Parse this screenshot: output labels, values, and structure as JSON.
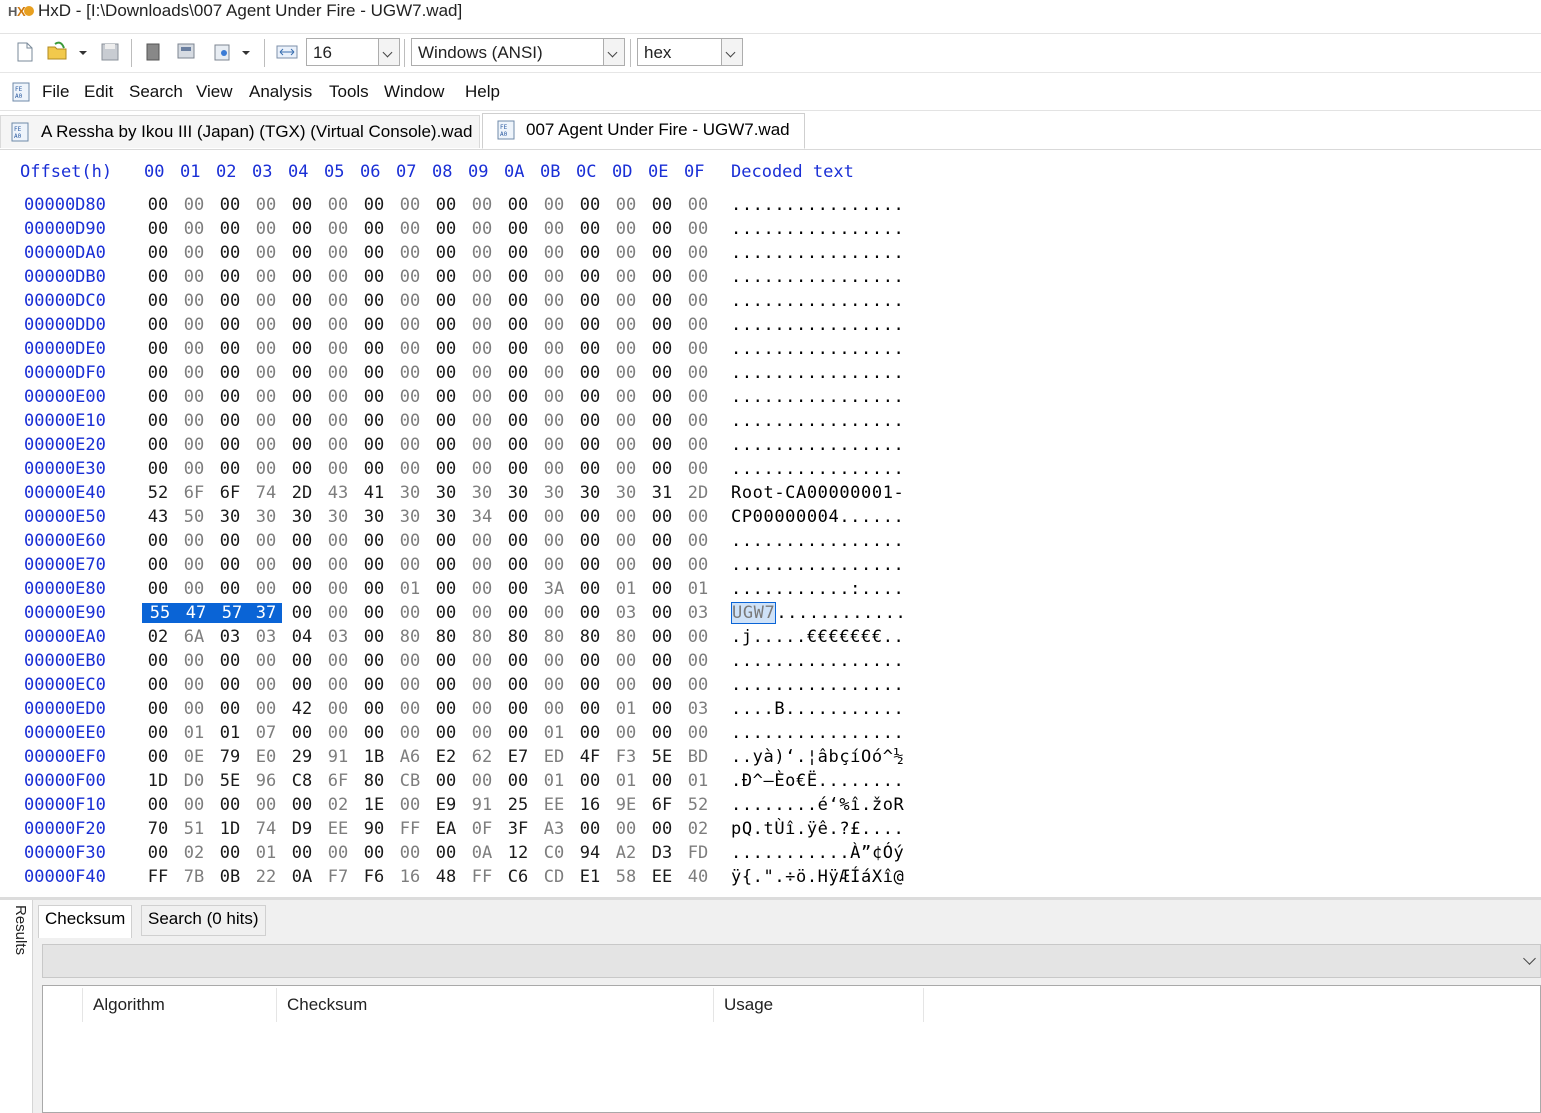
{
  "window": {
    "title": "HxD - [I:\\Downloads\\007 Agent Under Fire - UGW7.wad]"
  },
  "toolbar": {
    "bytes_per_row": "16",
    "charset": "Windows (ANSI)",
    "offset_base": "hex"
  },
  "menu": {
    "items": [
      "File",
      "Edit",
      "Search",
      "View",
      "Analysis",
      "Tools",
      "Window",
      "Help"
    ]
  },
  "tabs": [
    {
      "label": "A Ressha by Ikou III (Japan) (TGX) (Virtual Console).wad",
      "active": false
    },
    {
      "label": "007 Agent Under Fire - UGW7.wad",
      "active": true
    }
  ],
  "hexview": {
    "offset_header": "Offset(h)",
    "column_headers": [
      "00",
      "01",
      "02",
      "03",
      "04",
      "05",
      "06",
      "07",
      "08",
      "09",
      "0A",
      "0B",
      "0C",
      "0D",
      "0E",
      "0F"
    ],
    "decoded_header": "Decoded text",
    "selection": {
      "row": 17,
      "start": 0,
      "end": 3,
      "text": "UGW7"
    },
    "rows": [
      {
        "offset": "00000D80",
        "bytes": [
          "00",
          "00",
          "00",
          "00",
          "00",
          "00",
          "00",
          "00",
          "00",
          "00",
          "00",
          "00",
          "00",
          "00",
          "00",
          "00"
        ],
        "text": "................"
      },
      {
        "offset": "00000D90",
        "bytes": [
          "00",
          "00",
          "00",
          "00",
          "00",
          "00",
          "00",
          "00",
          "00",
          "00",
          "00",
          "00",
          "00",
          "00",
          "00",
          "00"
        ],
        "text": "................"
      },
      {
        "offset": "00000DA0",
        "bytes": [
          "00",
          "00",
          "00",
          "00",
          "00",
          "00",
          "00",
          "00",
          "00",
          "00",
          "00",
          "00",
          "00",
          "00",
          "00",
          "00"
        ],
        "text": "................"
      },
      {
        "offset": "00000DB0",
        "bytes": [
          "00",
          "00",
          "00",
          "00",
          "00",
          "00",
          "00",
          "00",
          "00",
          "00",
          "00",
          "00",
          "00",
          "00",
          "00",
          "00"
        ],
        "text": "................"
      },
      {
        "offset": "00000DC0",
        "bytes": [
          "00",
          "00",
          "00",
          "00",
          "00",
          "00",
          "00",
          "00",
          "00",
          "00",
          "00",
          "00",
          "00",
          "00",
          "00",
          "00"
        ],
        "text": "................"
      },
      {
        "offset": "00000DD0",
        "bytes": [
          "00",
          "00",
          "00",
          "00",
          "00",
          "00",
          "00",
          "00",
          "00",
          "00",
          "00",
          "00",
          "00",
          "00",
          "00",
          "00"
        ],
        "text": "................"
      },
      {
        "offset": "00000DE0",
        "bytes": [
          "00",
          "00",
          "00",
          "00",
          "00",
          "00",
          "00",
          "00",
          "00",
          "00",
          "00",
          "00",
          "00",
          "00",
          "00",
          "00"
        ],
        "text": "................"
      },
      {
        "offset": "00000DF0",
        "bytes": [
          "00",
          "00",
          "00",
          "00",
          "00",
          "00",
          "00",
          "00",
          "00",
          "00",
          "00",
          "00",
          "00",
          "00",
          "00",
          "00"
        ],
        "text": "................"
      },
      {
        "offset": "00000E00",
        "bytes": [
          "00",
          "00",
          "00",
          "00",
          "00",
          "00",
          "00",
          "00",
          "00",
          "00",
          "00",
          "00",
          "00",
          "00",
          "00",
          "00"
        ],
        "text": "................"
      },
      {
        "offset": "00000E10",
        "bytes": [
          "00",
          "00",
          "00",
          "00",
          "00",
          "00",
          "00",
          "00",
          "00",
          "00",
          "00",
          "00",
          "00",
          "00",
          "00",
          "00"
        ],
        "text": "................"
      },
      {
        "offset": "00000E20",
        "bytes": [
          "00",
          "00",
          "00",
          "00",
          "00",
          "00",
          "00",
          "00",
          "00",
          "00",
          "00",
          "00",
          "00",
          "00",
          "00",
          "00"
        ],
        "text": "................"
      },
      {
        "offset": "00000E30",
        "bytes": [
          "00",
          "00",
          "00",
          "00",
          "00",
          "00",
          "00",
          "00",
          "00",
          "00",
          "00",
          "00",
          "00",
          "00",
          "00",
          "00"
        ],
        "text": "................"
      },
      {
        "offset": "00000E40",
        "bytes": [
          "52",
          "6F",
          "6F",
          "74",
          "2D",
          "43",
          "41",
          "30",
          "30",
          "30",
          "30",
          "30",
          "30",
          "30",
          "31",
          "2D"
        ],
        "text": "Root-CA00000001-"
      },
      {
        "offset": "00000E50",
        "bytes": [
          "43",
          "50",
          "30",
          "30",
          "30",
          "30",
          "30",
          "30",
          "30",
          "34",
          "00",
          "00",
          "00",
          "00",
          "00",
          "00"
        ],
        "text": "CP00000004......"
      },
      {
        "offset": "00000E60",
        "bytes": [
          "00",
          "00",
          "00",
          "00",
          "00",
          "00",
          "00",
          "00",
          "00",
          "00",
          "00",
          "00",
          "00",
          "00",
          "00",
          "00"
        ],
        "text": "................"
      },
      {
        "offset": "00000E70",
        "bytes": [
          "00",
          "00",
          "00",
          "00",
          "00",
          "00",
          "00",
          "00",
          "00",
          "00",
          "00",
          "00",
          "00",
          "00",
          "00",
          "00"
        ],
        "text": "................"
      },
      {
        "offset": "00000E80",
        "bytes": [
          "00",
          "00",
          "00",
          "00",
          "00",
          "00",
          "00",
          "01",
          "00",
          "00",
          "00",
          "3A",
          "00",
          "01",
          "00",
          "01"
        ],
        "text": "...........:...."
      },
      {
        "offset": "00000E90",
        "bytes": [
          "55",
          "47",
          "57",
          "37",
          "00",
          "00",
          "00",
          "00",
          "00",
          "00",
          "00",
          "00",
          "00",
          "03",
          "00",
          "03"
        ],
        "text": "UGW7............"
      },
      {
        "offset": "00000EA0",
        "bytes": [
          "02",
          "6A",
          "03",
          "03",
          "04",
          "03",
          "00",
          "80",
          "80",
          "80",
          "80",
          "80",
          "80",
          "80",
          "00",
          "00"
        ],
        "text": ".j.....€€€€€€€.."
      },
      {
        "offset": "00000EB0",
        "bytes": [
          "00",
          "00",
          "00",
          "00",
          "00",
          "00",
          "00",
          "00",
          "00",
          "00",
          "00",
          "00",
          "00",
          "00",
          "00",
          "00"
        ],
        "text": "................"
      },
      {
        "offset": "00000EC0",
        "bytes": [
          "00",
          "00",
          "00",
          "00",
          "00",
          "00",
          "00",
          "00",
          "00",
          "00",
          "00",
          "00",
          "00",
          "00",
          "00",
          "00"
        ],
        "text": "................"
      },
      {
        "offset": "00000ED0",
        "bytes": [
          "00",
          "00",
          "00",
          "00",
          "42",
          "00",
          "00",
          "00",
          "00",
          "00",
          "00",
          "00",
          "00",
          "01",
          "00",
          "03"
        ],
        "text": "....B..........."
      },
      {
        "offset": "00000EE0",
        "bytes": [
          "00",
          "01",
          "01",
          "07",
          "00",
          "00",
          "00",
          "00",
          "00",
          "00",
          "00",
          "01",
          "00",
          "00",
          "00",
          "00"
        ],
        "text": "................"
      },
      {
        "offset": "00000EF0",
        "bytes": [
          "00",
          "0E",
          "79",
          "E0",
          "29",
          "91",
          "1B",
          "A6",
          "E2",
          "62",
          "E7",
          "ED",
          "4F",
          "F3",
          "5E",
          "BD"
        ],
        "text": "..yà)‘.¦âbçíOó^½"
      },
      {
        "offset": "00000F00",
        "bytes": [
          "1D",
          "D0",
          "5E",
          "96",
          "C8",
          "6F",
          "80",
          "CB",
          "00",
          "00",
          "00",
          "01",
          "00",
          "01",
          "00",
          "01"
        ],
        "text": ".Ð^–Èo€Ë........"
      },
      {
        "offset": "00000F10",
        "bytes": [
          "00",
          "00",
          "00",
          "00",
          "00",
          "02",
          "1E",
          "00",
          "E9",
          "91",
          "25",
          "EE",
          "16",
          "9E",
          "6F",
          "52"
        ],
        "text": "........é‘%î.žoR"
      },
      {
        "offset": "00000F20",
        "bytes": [
          "70",
          "51",
          "1D",
          "74",
          "D9",
          "EE",
          "90",
          "FF",
          "EA",
          "0F",
          "3F",
          "A3",
          "00",
          "00",
          "00",
          "02"
        ],
        "text": "pQ.tÙî.ÿê.?£...."
      },
      {
        "offset": "00000F30",
        "bytes": [
          "00",
          "02",
          "00",
          "01",
          "00",
          "00",
          "00",
          "00",
          "00",
          "0A",
          "12",
          "C0",
          "94",
          "A2",
          "D3",
          "FD"
        ],
        "text": "...........À”¢Óý"
      },
      {
        "offset": "00000F40",
        "bytes": [
          "FF",
          "7B",
          "0B",
          "22",
          "0A",
          "F7",
          "F6",
          "16",
          "48",
          "FF",
          "C6",
          "CD",
          "E1",
          "58",
          "EE",
          "40"
        ],
        "text": "ÿ{.\".÷ö.HÿÆÍáXî@"
      }
    ]
  },
  "results": {
    "panel_label": "Results",
    "tabs": [
      "Checksum",
      "Search (0 hits)"
    ],
    "columns": [
      "Algorithm",
      "Checksum",
      "Usage"
    ]
  }
}
